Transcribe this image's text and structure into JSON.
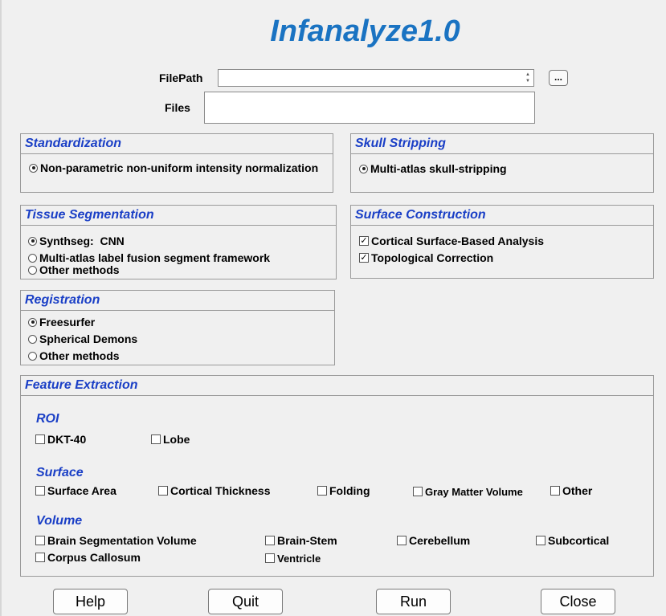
{
  "app": {
    "title": "Infanalyze1.0"
  },
  "file": {
    "filepath_label": "FilePath",
    "filepath_value": "",
    "browse_label": "...",
    "files_label": "Files",
    "files_value": ""
  },
  "standardization": {
    "title": "Standardization",
    "options": [
      {
        "label": "Non-parametric non-uniform intensity normalization",
        "selected": true
      }
    ]
  },
  "skull_stripping": {
    "title": "Skull Stripping",
    "options": [
      {
        "label": "Multi-atlas skull-stripping",
        "selected": true
      }
    ]
  },
  "tissue_segmentation": {
    "title": "Tissue Segmentation",
    "options": [
      {
        "label": "Synthseg:  CNN",
        "selected": true
      },
      {
        "label": "Multi-atlas label fusion segment framework",
        "selected": false
      },
      {
        "label": "Other methods",
        "selected": false
      }
    ]
  },
  "surface_construction": {
    "title": "Surface Construction",
    "options": [
      {
        "label": "Cortical Surface-Based Analysis",
        "checked": true
      },
      {
        "label": "Topological Correction",
        "checked": true
      }
    ]
  },
  "registration": {
    "title": "Registration",
    "options": [
      {
        "label": "Freesurfer",
        "selected": true
      },
      {
        "label": "Spherical Demons",
        "selected": false
      },
      {
        "label": "Other methods",
        "selected": false
      }
    ]
  },
  "feature_extraction": {
    "title": "Feature Extraction",
    "roi": {
      "heading": "ROI",
      "items": [
        {
          "label": "DKT-40",
          "checked": false
        },
        {
          "label": "Lobe",
          "checked": false
        }
      ]
    },
    "surface": {
      "heading": "Surface",
      "items": [
        {
          "label": "Surface Area",
          "checked": false
        },
        {
          "label": "Cortical Thickness",
          "checked": false
        },
        {
          "label": "Folding",
          "checked": false
        },
        {
          "label": "Gray Matter Volume",
          "checked": false
        },
        {
          "label": "Other",
          "checked": false
        }
      ]
    },
    "volume": {
      "heading": "Volume",
      "items": [
        {
          "label": "Brain Segmentation Volume",
          "checked": false
        },
        {
          "label": "Brain-Stem",
          "checked": false
        },
        {
          "label": "Cerebellum",
          "checked": false
        },
        {
          "label": "Subcortical",
          "checked": false
        },
        {
          "label": "Corpus Callosum",
          "checked": false
        },
        {
          "label": "Ventricle",
          "checked": false
        }
      ]
    }
  },
  "buttons": {
    "help": "Help",
    "quit": "Quit",
    "run": "Run",
    "close": "Close"
  },
  "colors": {
    "title": "#1a73c2",
    "section_heading": "#1a3fc6",
    "background": "#f0f0f0"
  }
}
